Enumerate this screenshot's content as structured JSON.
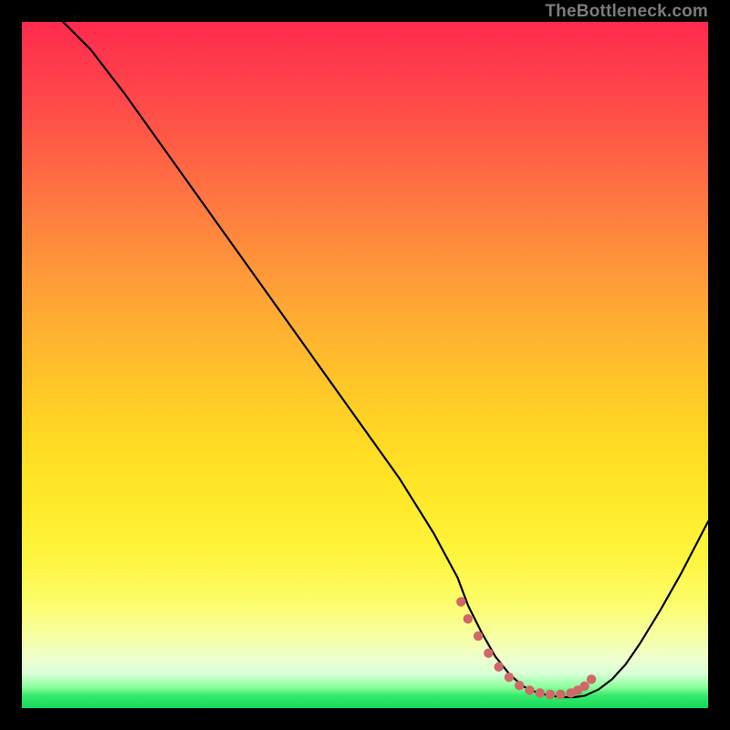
{
  "watermark": "TheBottleneck.com",
  "chart_data": {
    "type": "line",
    "title": "",
    "xlabel": "",
    "ylabel": "",
    "xlim": [
      0,
      100
    ],
    "ylim": [
      0,
      100
    ],
    "grid": false,
    "legend": false,
    "background": "rainbow-gradient-red-to-green",
    "border": "#000000",
    "series": [
      {
        "name": "bottleneck-curve",
        "color": "#000000",
        "x": [
          6,
          10,
          15,
          20,
          25,
          30,
          35,
          40,
          45,
          50,
          55,
          60,
          63.5,
          65,
          67,
          69,
          71,
          73,
          75,
          77,
          79,
          80.5,
          82,
          84,
          86,
          88,
          90,
          93,
          96,
          100
        ],
        "y": [
          100,
          96,
          89.5,
          82.5,
          75.5,
          68.5,
          61.5,
          54.5,
          47.5,
          40.5,
          33.5,
          25.5,
          19,
          15,
          11,
          7.5,
          5,
          3.2,
          2.3,
          1.8,
          1.6,
          1.6,
          1.8,
          2.7,
          4.2,
          6.4,
          9.3,
          14.2,
          19.5,
          27.2
        ]
      },
      {
        "name": "optimal-zone-dots",
        "color": "#d06868",
        "marker": "dot",
        "x": [
          64,
          65,
          66.5,
          68,
          69.5,
          71,
          72.5,
          74,
          75.5,
          77,
          78.5,
          80,
          81,
          82,
          83
        ],
        "y": [
          15.5,
          13,
          10.5,
          8,
          6,
          4.5,
          3.3,
          2.6,
          2.2,
          2,
          2,
          2.2,
          2.6,
          3.2,
          4.2
        ]
      }
    ]
  }
}
